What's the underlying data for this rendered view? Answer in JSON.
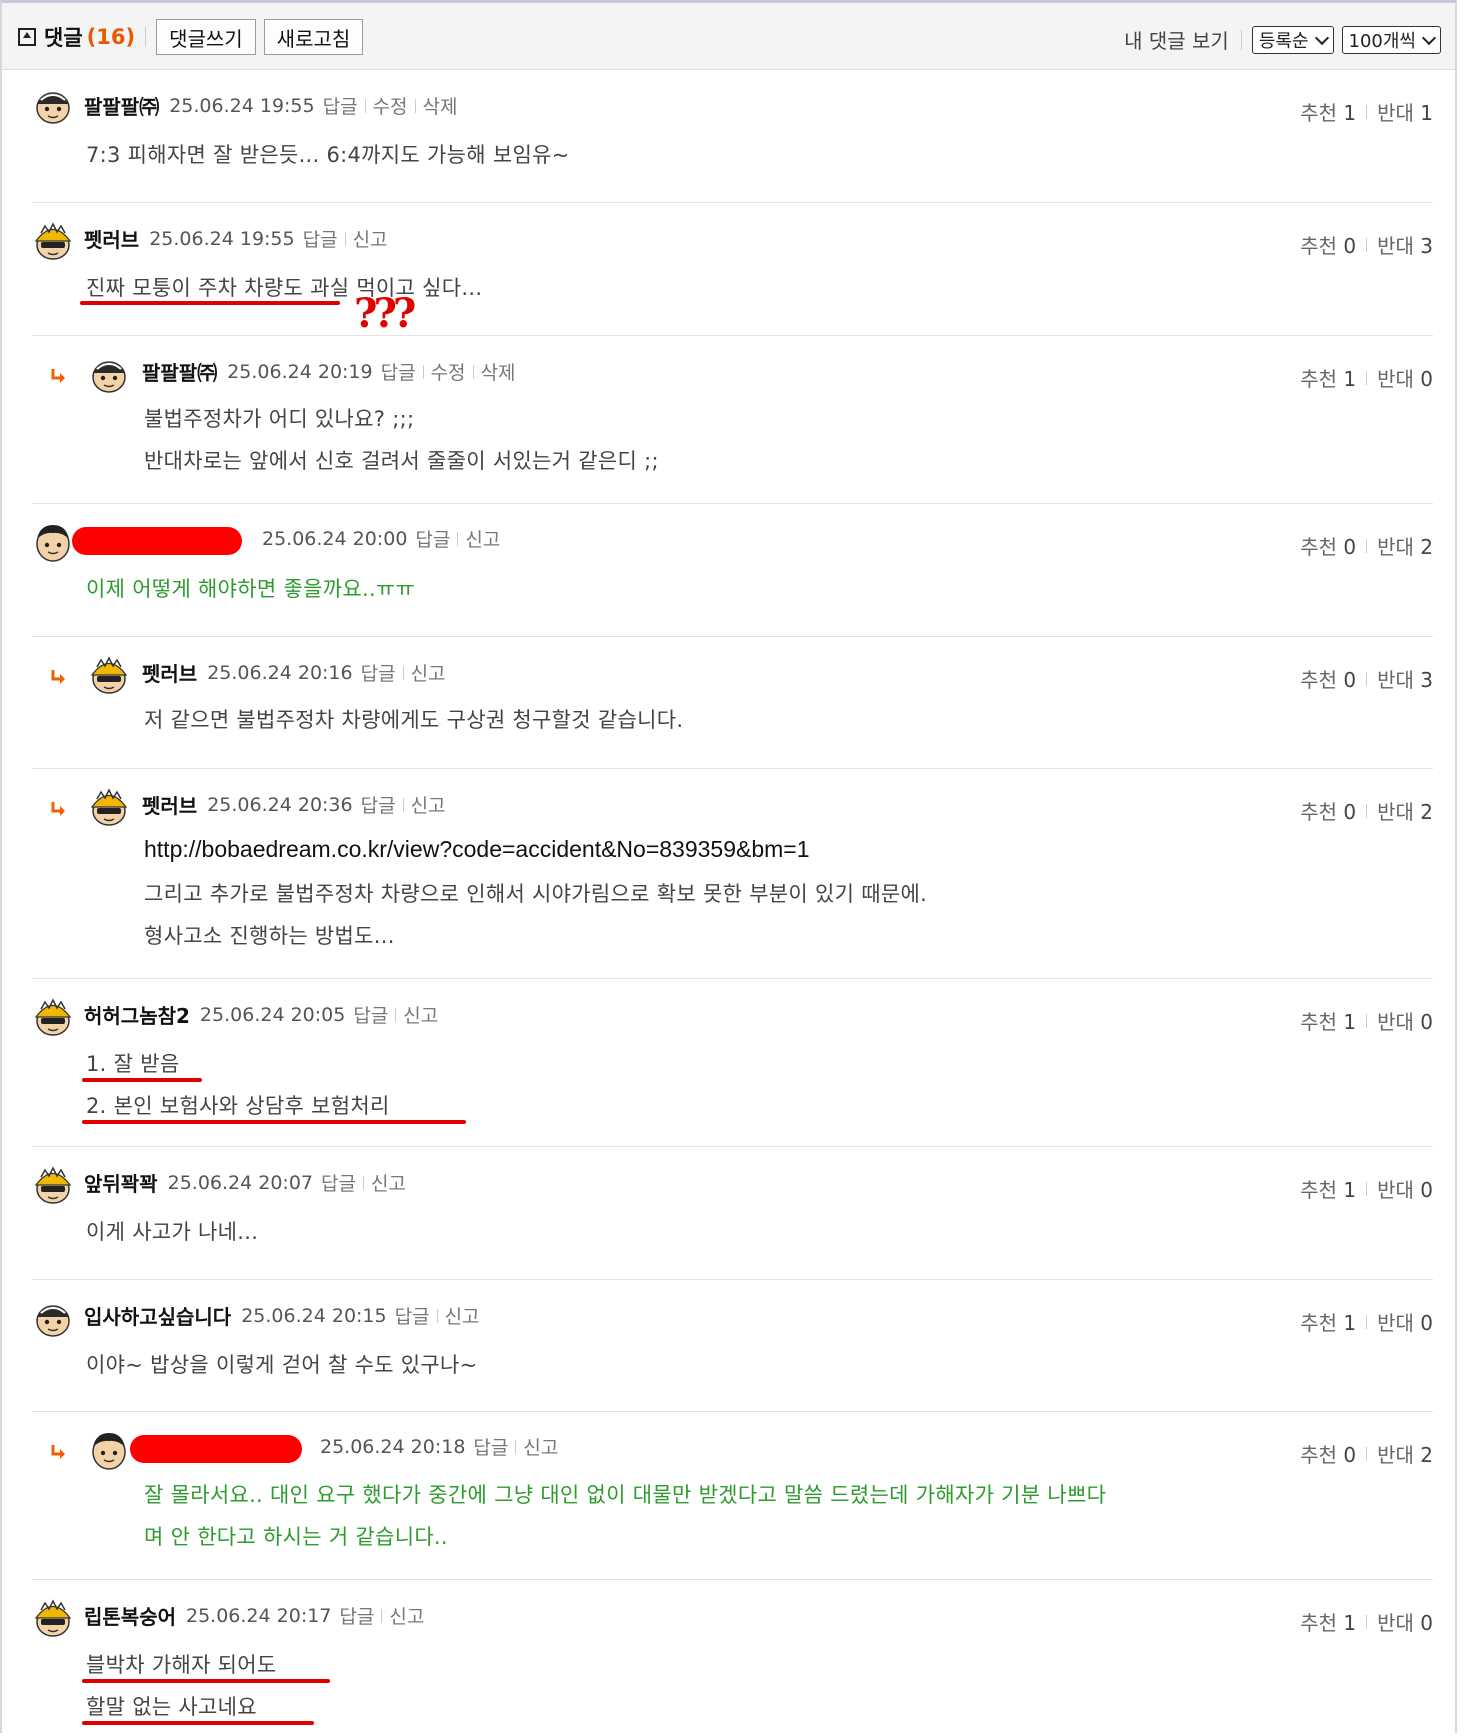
{
  "header": {
    "title": "댓글",
    "count": "(16)",
    "write_button": "댓글쓰기",
    "refresh_button": "새로고침",
    "my_comments": "내 댓글 보기",
    "sort_select": "등록순",
    "per_page_select": "100개씩"
  },
  "comments": [
    {
      "nick": "팔팔팔㈜",
      "date": "25.06.24 19:55",
      "actions": [
        "답글",
        "수정",
        "삭제"
      ],
      "up": "추천",
      "up_n": "1",
      "down": "반대",
      "down_n": "1",
      "lines": [
        "7:3 피해자면 잘 받은듯... 6:4까지도 가능해 보임유~"
      ]
    },
    {
      "nick": "펫러브",
      "date": "25.06.24 19:55",
      "actions": [
        "답글",
        "신고"
      ],
      "up": "추천",
      "up_n": "0",
      "down": "반대",
      "down_n": "3",
      "lines": [
        "진짜 모퉁이 주차 차량도 과실 먹이고 싶다..."
      ]
    },
    {
      "nick": "팔팔팔㈜",
      "date": "25.06.24 20:19",
      "actions": [
        "답글",
        "수정",
        "삭제"
      ],
      "up": "추천",
      "up_n": "1",
      "down": "반대",
      "down_n": "0",
      "lines": [
        "불법주정차가 어디 있나요? ;;;",
        "반대차로는 앞에서 신호 걸려서 줄줄이 서있는거 같은디 ;;"
      ]
    },
    {
      "nick": "",
      "date": "25.06.24 20:00",
      "actions": [
        "답글",
        "신고"
      ],
      "up": "추천",
      "up_n": "0",
      "down": "반대",
      "down_n": "2",
      "lines": [
        "이제 어떻게 해야하면 좋을까요..ㅠㅠ"
      ]
    },
    {
      "nick": "펫러브",
      "date": "25.06.24 20:16",
      "actions": [
        "답글",
        "신고"
      ],
      "up": "추천",
      "up_n": "0",
      "down": "반대",
      "down_n": "3",
      "lines": [
        "저 같으면 불법주정차 차량에게도 구상권 청구할것 같습니다."
      ]
    },
    {
      "nick": "펫러브",
      "date": "25.06.24 20:36",
      "actions": [
        "답글",
        "신고"
      ],
      "up": "추천",
      "up_n": "0",
      "down": "반대",
      "down_n": "2",
      "lines": [
        "http://bobaedream.co.kr/view?code=accident&No=839359&bm=1",
        "그리고 추가로 불법주정차 차량으로 인해서 시야가림으로 확보 못한 부분이 있기 때문에.",
        "형사고소 진행하는 방법도..."
      ]
    },
    {
      "nick": "허허그놈참2",
      "date": "25.06.24 20:05",
      "actions": [
        "답글",
        "신고"
      ],
      "up": "추천",
      "up_n": "1",
      "down": "반대",
      "down_n": "0",
      "lines": [
        "1. 잘 받음",
        "2. 본인 보험사와 상담후 보험처리"
      ]
    },
    {
      "nick": "앞뒤꽉꽉",
      "date": "25.06.24 20:07",
      "actions": [
        "답글",
        "신고"
      ],
      "up": "추천",
      "up_n": "1",
      "down": "반대",
      "down_n": "0",
      "lines": [
        "이게 사고가 나네..."
      ]
    },
    {
      "nick": "입사하고싶습니다",
      "date": "25.06.24 20:15",
      "actions": [
        "답글",
        "신고"
      ],
      "up": "추천",
      "up_n": "1",
      "down": "반대",
      "down_n": "0",
      "lines": [
        "이야~ 밥상을 이렇게 걷어 찰 수도 있구나~"
      ]
    },
    {
      "nick": "",
      "date": "25.06.24 20:18",
      "actions": [
        "답글",
        "신고"
      ],
      "up": "추천",
      "up_n": "0",
      "down": "반대",
      "down_n": "2",
      "lines": [
        "잘 몰라서요.. 대인 요구 했다가 중간에 그냥 대인 없이 대물만 받겠다고 말씀 드렸는데 가해자가 기분 나쁘다",
        "며 안 한다고 하시는 거 같습니다.."
      ]
    },
    {
      "nick": "립톤복숭어",
      "date": "25.06.24 20:17",
      "actions": [
        "답글",
        "신고"
      ],
      "up": "추천",
      "up_n": "1",
      "down": "반대",
      "down_n": "0",
      "lines": [
        "블박차 가해자 되어도",
        "할말 없는 사고네요"
      ]
    }
  ],
  "annotation": {
    "qmarks": "???"
  },
  "colors": {
    "accent": "#e85a00",
    "green_text": "#2e9b2e",
    "markup_red": "#e00000",
    "reply_arrow": "#f06000"
  }
}
